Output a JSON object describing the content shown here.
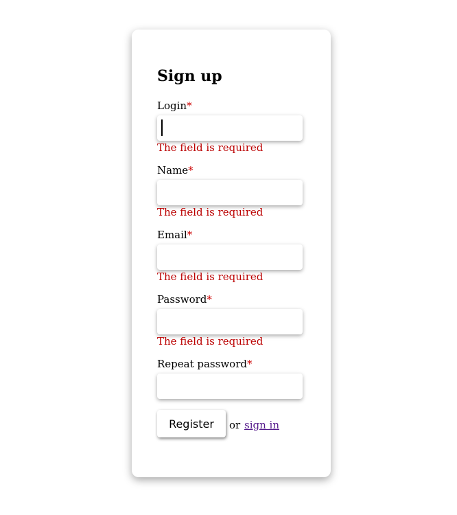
{
  "form": {
    "title": "Sign up",
    "required_mark": "*",
    "fields": [
      {
        "label": "Login",
        "value": "",
        "error": "The field is required"
      },
      {
        "label": "Name",
        "value": "",
        "error": "The field is required"
      },
      {
        "label": "Email",
        "value": "",
        "error": "The field is required"
      },
      {
        "label": "Password",
        "value": "",
        "error": "The field is required"
      },
      {
        "label": "Repeat password",
        "value": ""
      }
    ],
    "submit_label": "Register",
    "or_text": "or",
    "signin_label": "sign in"
  },
  "colors": {
    "required": "#cc0000",
    "error": "#bb0000",
    "link": "#551a8b"
  }
}
